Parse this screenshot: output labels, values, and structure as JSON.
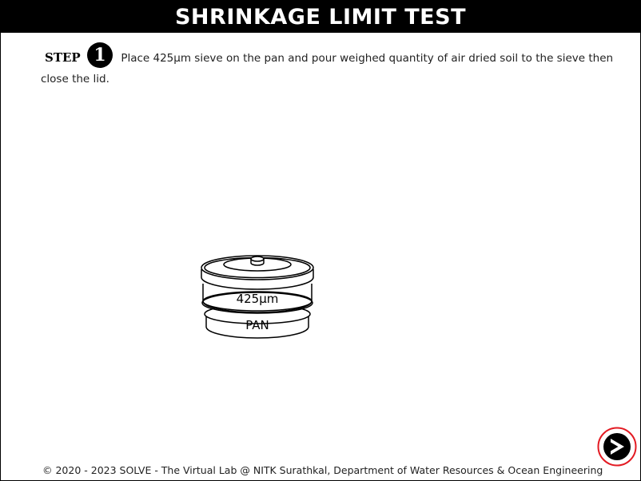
{
  "header": {
    "title": "SHRINKAGE LIMIT TEST"
  },
  "instruction": {
    "step_label": "STEP",
    "step_number": "1",
    "text": "Place 425µm sieve on the pan and pour weighed quantity of air dried soil to the sieve then close the lid."
  },
  "apparatus": {
    "sieve_label": "425µm",
    "pan_label": "PAN"
  },
  "footer": {
    "copyright": "© 2020 - 2023 SOLVE - The Virtual Lab @ NITK Surathkal, Department of Water Resources & Ocean Engineering"
  },
  "navigation": {
    "next_icon": "next-arrow-icon",
    "accent_color": "#e31b23"
  }
}
